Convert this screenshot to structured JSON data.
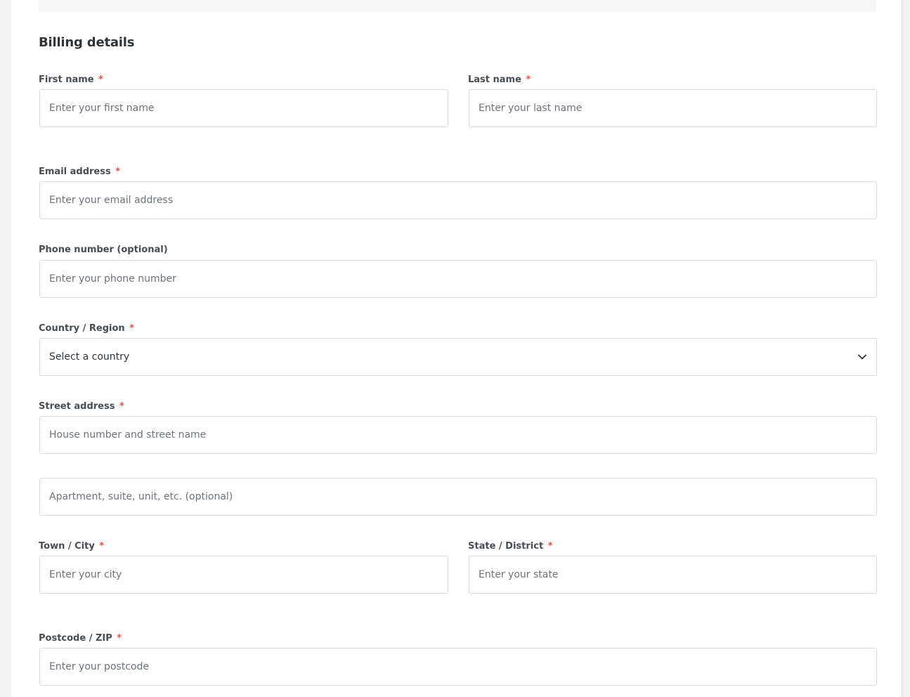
{
  "section": {
    "title": "Billing details"
  },
  "fields": {
    "first_name": {
      "label": "First name",
      "required_mark": "*",
      "placeholder": "Enter your first name"
    },
    "last_name": {
      "label": "Last name",
      "required_mark": "*",
      "placeholder": "Enter your last name"
    },
    "email": {
      "label": "Email address",
      "required_mark": "*",
      "placeholder": "Enter your email address"
    },
    "phone": {
      "label": "Phone number (optional)",
      "placeholder": "Enter your phone number"
    },
    "country": {
      "label": "Country / Region",
      "required_mark": "*",
      "selected": "Select a country",
      "icon": "chevron-down-icon"
    },
    "street": {
      "label": "Street address",
      "required_mark": "*",
      "placeholder": "House number and street name"
    },
    "apartment": {
      "placeholder": "Apartment, suite, unit, etc. (optional)"
    },
    "city": {
      "label": "Town / City",
      "required_mark": "*",
      "placeholder": "Enter your city"
    },
    "state": {
      "label": "State / District",
      "required_mark": "*",
      "placeholder": "Enter your state"
    },
    "postcode": {
      "label": "Postcode / ZIP",
      "required_mark": "*",
      "placeholder": "Enter your postcode"
    }
  },
  "colors": {
    "required": "#e2504c",
    "border": "#d6d9dd",
    "placeholder": "#6d737a"
  }
}
